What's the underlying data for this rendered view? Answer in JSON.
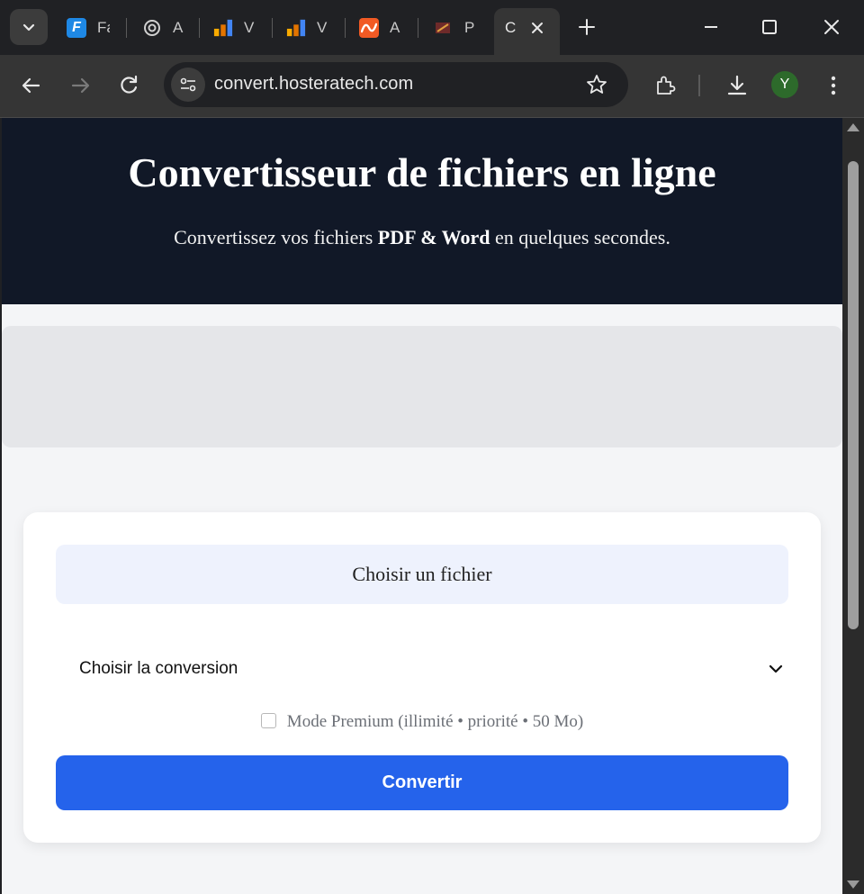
{
  "browser": {
    "tabs": [
      {
        "title": "Fa",
        "icon": "f-logo-icon",
        "color": "#1e88e5"
      },
      {
        "title": "A",
        "icon": "openai-icon",
        "color": "#d0d0d0"
      },
      {
        "title": "V",
        "icon": "analytics-icon",
        "color": "#f9ab00"
      },
      {
        "title": "V",
        "icon": "analytics-icon",
        "color": "#f9ab00"
      },
      {
        "title": "A",
        "icon": "orange-wave-icon",
        "color": "#f15a24"
      },
      {
        "title": "P",
        "icon": "paint-icon",
        "color": "#b23b3b"
      }
    ],
    "active_tab": {
      "title": "C"
    },
    "url": "convert.hosteratech.com",
    "profile_initial": "Y"
  },
  "hero": {
    "title": "Convertisseur de fichiers en ligne",
    "subtitle_prefix": "Convertissez vos fichiers ",
    "subtitle_bold": "PDF & Word",
    "subtitle_suffix": " en quelques secondes."
  },
  "form": {
    "file_button": "Choisir un fichier",
    "conversion_select": "Choisir la conversion",
    "premium_label": "Mode Premium (illimité • priorité • 50 Mo)",
    "premium_checked": false,
    "convert_button": "Convertir"
  },
  "colors": {
    "hero_bg": "#111827",
    "primary": "#2563eb",
    "file_button_bg": "#eef2fd",
    "page_bg": "#f4f5f7"
  }
}
